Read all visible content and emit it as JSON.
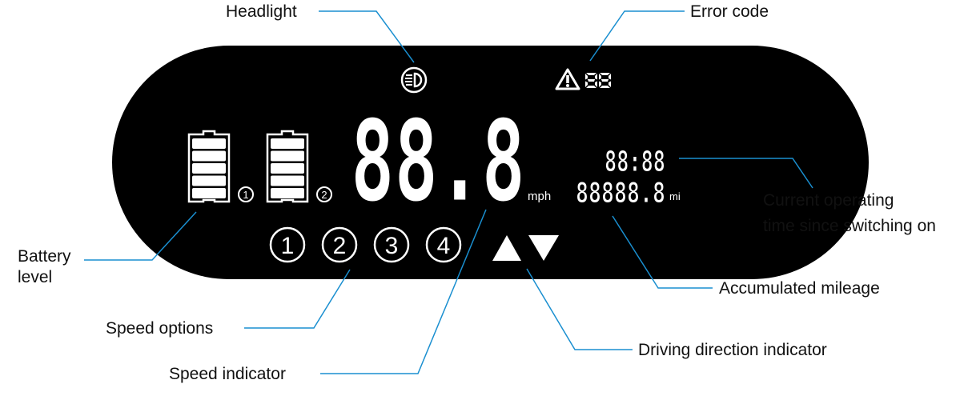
{
  "colors": {
    "display": "#000000",
    "segments": "#ffffff",
    "leader_lines": "#1a8fd0",
    "label_text": "#111111"
  },
  "display": {
    "speed": "88.8",
    "speed_unit": "mph",
    "time": "88:88",
    "mileage": "88888.8",
    "mileage_unit": "mi",
    "error_code": "88",
    "battery_labels": [
      "1",
      "2"
    ],
    "speed_options": [
      "1",
      "2",
      "3",
      "4"
    ],
    "icons": [
      "headlight-icon",
      "warning-triangle-icon",
      "battery-icon",
      "direction-up-arrow-icon",
      "direction-down-arrow-icon"
    ]
  },
  "labels": {
    "headlight": "Headlight",
    "error_code": "Error code",
    "operating_time_line1": "Current operating",
    "operating_time_line2": "time since switching on",
    "mileage": "Accumulated mileage",
    "direction": "Driving direction indicator",
    "speed_indicator": "Speed indicator",
    "speed_options": "Speed options",
    "battery_line1": "Battery",
    "battery_line2": "level"
  }
}
